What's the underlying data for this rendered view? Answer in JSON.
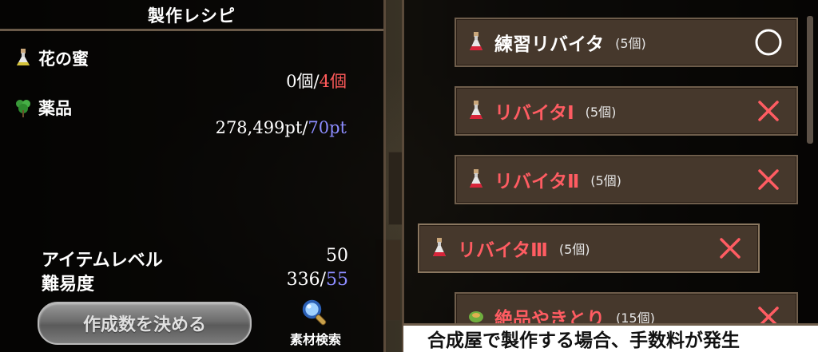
{
  "panel": {
    "title": "製作レシピ"
  },
  "materials": [
    {
      "name": "花の蜜",
      "have": "0個",
      "sep": "/",
      "need": "4個",
      "icon": "potion-icon"
    },
    {
      "name": "薬品",
      "have": "278,499pt",
      "sep": "/",
      "need": "70pt",
      "icon": "herb-icon"
    }
  ],
  "stats": {
    "item_level_label": "アイテムレベル",
    "item_level_value": "50",
    "difficulty_label": "難易度",
    "difficulty_have": "336",
    "difficulty_sep": "/",
    "difficulty_need": "55"
  },
  "buttons": {
    "make_label": "作成数を決める",
    "search_label": "素材検索"
  },
  "recipes": [
    {
      "name": "練習リバイタ",
      "qty": "(5個)",
      "status": "○",
      "color": "#ffffff"
    },
    {
      "name": "リバイタⅠ",
      "qty": "(5個)",
      "status": "×",
      "color": "#ff5c62"
    },
    {
      "name": "リバイタⅡ",
      "qty": "(5個)",
      "status": "×",
      "color": "#ff5c62"
    },
    {
      "name": "リバイタⅢ",
      "qty": "(5個)",
      "status": "×",
      "color": "#ff5c62"
    },
    {
      "name": "絶品やきとり",
      "qty": "(15個)",
      "status": "×",
      "color": "#ff5c62"
    }
  ],
  "message": "合成屋で製作する場合、手数料が発生"
}
